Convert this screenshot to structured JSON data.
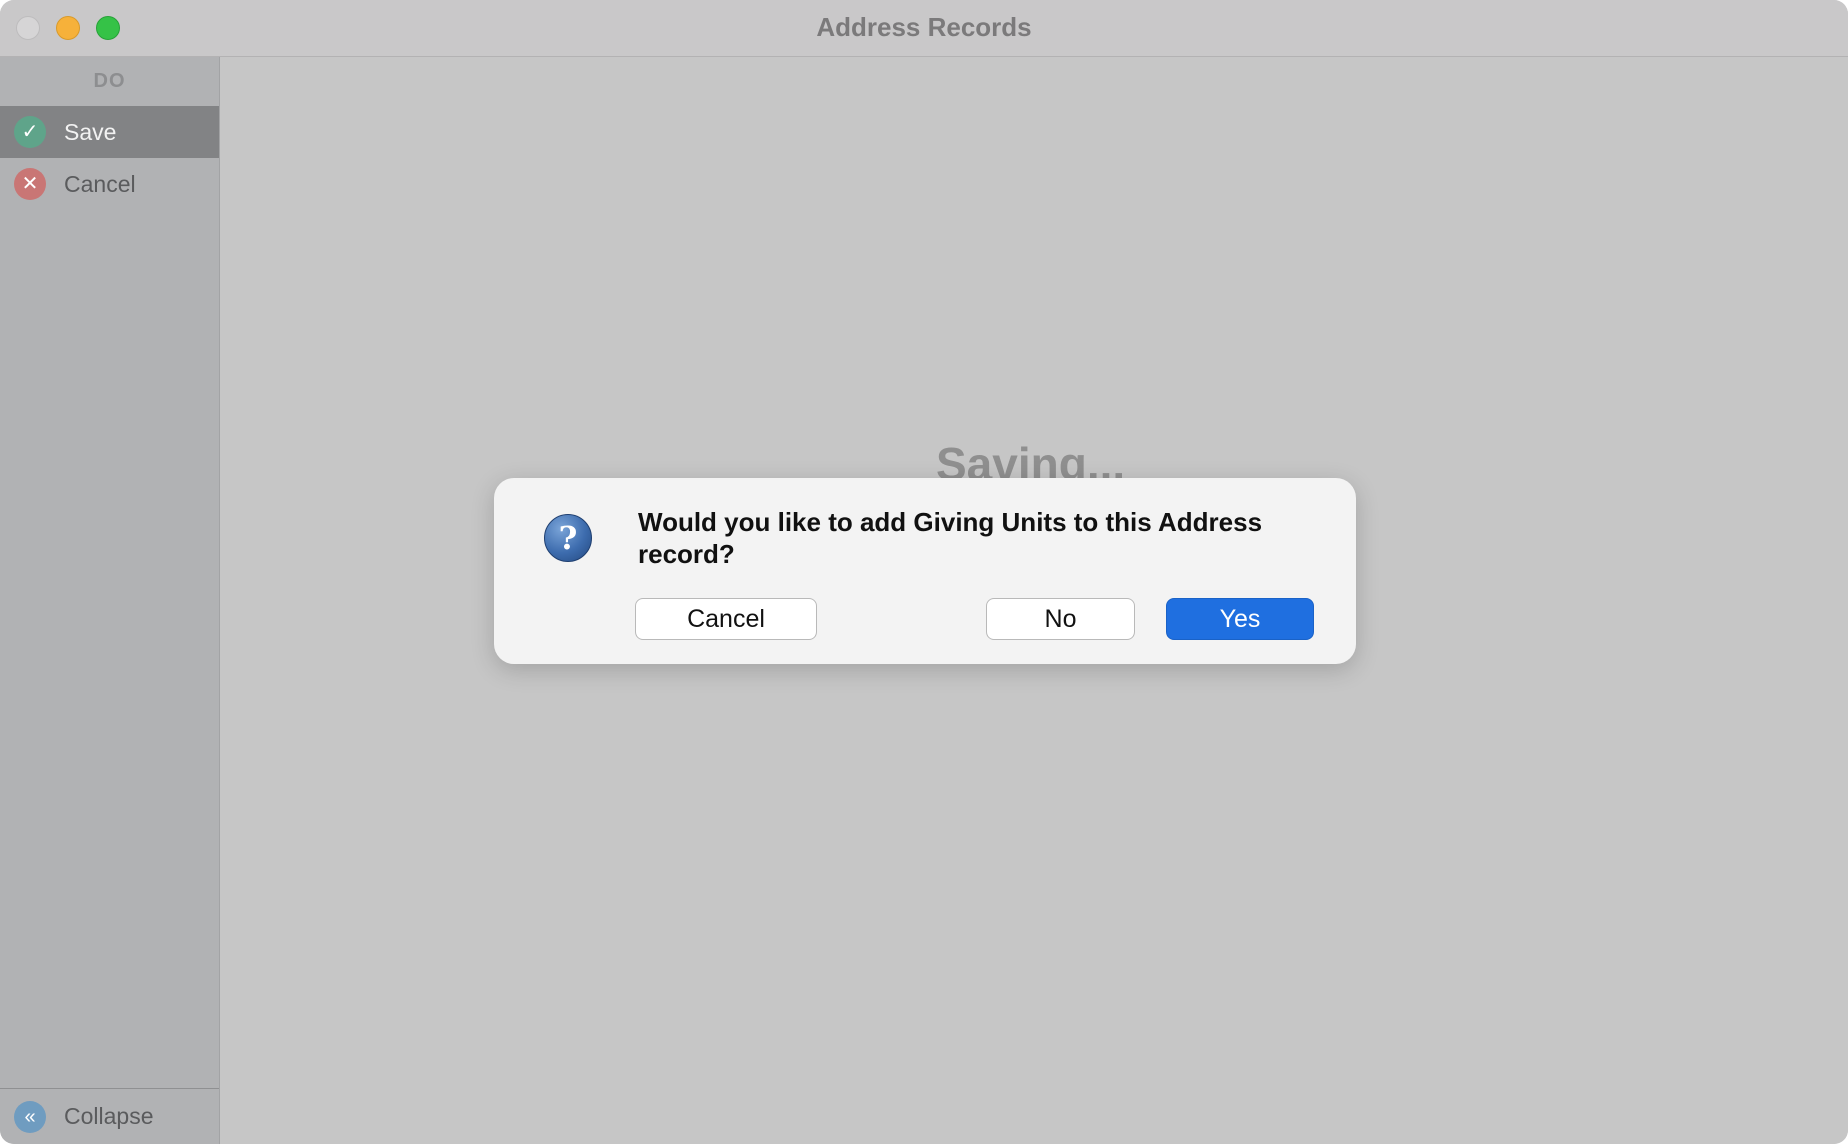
{
  "window": {
    "title": "Address Records"
  },
  "sidebar": {
    "header": "DO",
    "items": [
      {
        "label": "Save",
        "icon": "check-icon",
        "selected": true
      },
      {
        "label": "Cancel",
        "icon": "x-icon",
        "selected": false
      }
    ],
    "collapse_label": "Collapse"
  },
  "content": {
    "status_text": "Saving..."
  },
  "dialog": {
    "message": "Would you like to add Giving Units to this Address record?",
    "icon": "question-icon",
    "buttons": {
      "cancel": "Cancel",
      "no": "No",
      "yes": "Yes"
    }
  },
  "colors": {
    "accent": "#1f6fe0",
    "save_icon": "#5fa48a",
    "cancel_icon": "#c97675",
    "collapse_icon": "#6f9cc0"
  }
}
